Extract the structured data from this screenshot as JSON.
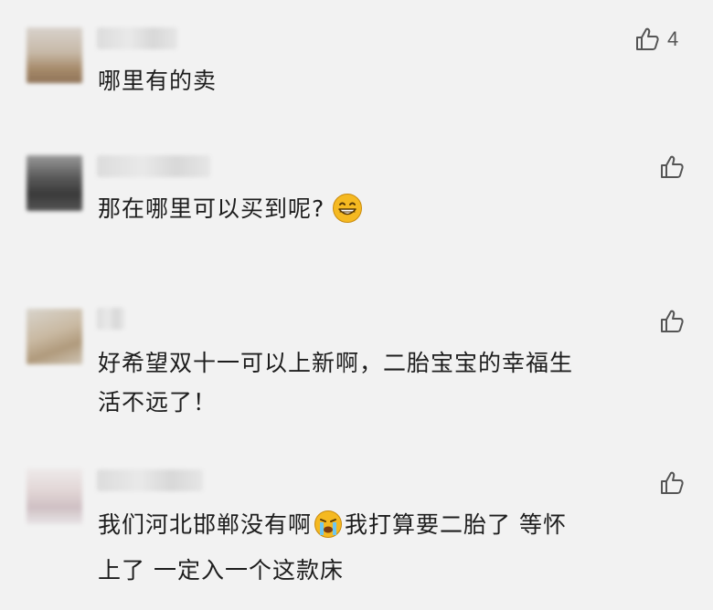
{
  "comments": [
    {
      "text": "哪里有的卖",
      "likes": "4",
      "like_icon": "thumbs-up-icon"
    },
    {
      "text": "那在哪里可以买到呢?",
      "emoji": "grinning-face-icon",
      "like_icon": "thumbs-up-icon"
    },
    {
      "text_line1": "好希望双十一可以上新啊，二胎宝宝的幸福生",
      "text_line2": "活不远了！",
      "like_icon": "thumbs-up-icon"
    },
    {
      "text_part1": "我们河北邯郸没有啊",
      "emoji": "loudly-crying-face-icon",
      "text_part2": "我打算要二胎了 等怀",
      "text_line2": "上了 一定入一个这款床",
      "like_icon": "thumbs-up-icon"
    }
  ],
  "colors": {
    "background": "#f2f2f2",
    "text": "#1d1d1d",
    "icon": "#555555",
    "emoji": "#f5b921"
  }
}
